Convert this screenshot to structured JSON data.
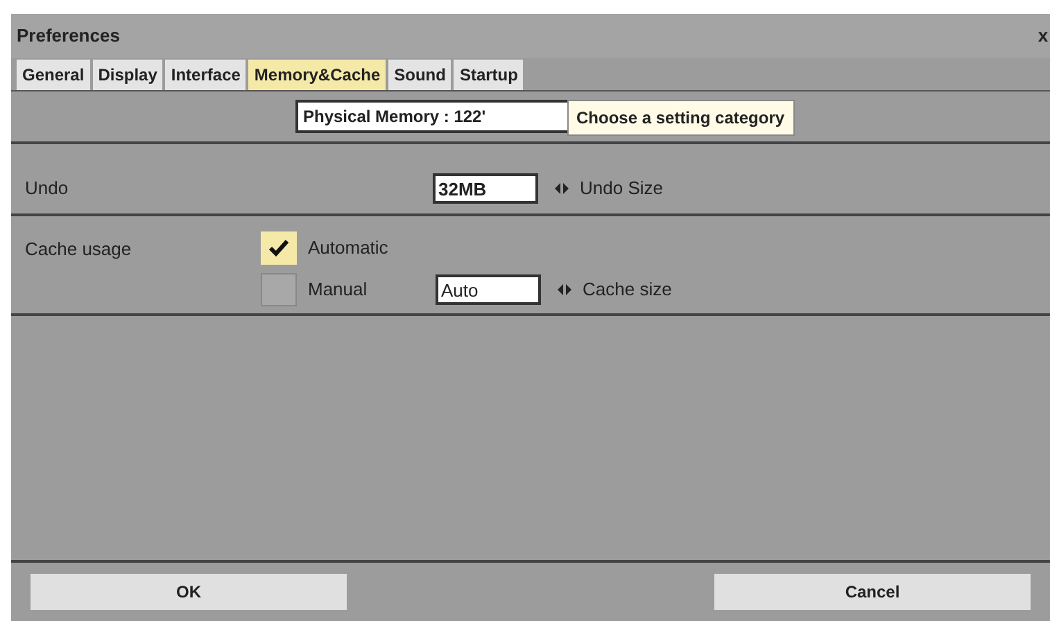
{
  "window": {
    "title": "Preferences",
    "close": "x"
  },
  "tabs": [
    {
      "label": "General",
      "selected": false
    },
    {
      "label": "Display",
      "selected": false
    },
    {
      "label": "Interface",
      "selected": false
    },
    {
      "label": "Memory&Cache",
      "selected": true
    },
    {
      "label": "Sound",
      "selected": false
    },
    {
      "label": "Startup",
      "selected": false
    }
  ],
  "memory_info": "Physical Memory : 122'",
  "tooltip": "Choose a setting category",
  "undo": {
    "label": "Undo",
    "value": "32MB",
    "unit_label": "Undo Size"
  },
  "cache": {
    "label": "Cache usage",
    "options": [
      {
        "label": "Automatic",
        "checked": true
      },
      {
        "label": "Manual",
        "checked": false
      }
    ],
    "value": "Auto",
    "unit_label": "Cache size"
  },
  "buttons": [
    "OK",
    "Cancel"
  ]
}
